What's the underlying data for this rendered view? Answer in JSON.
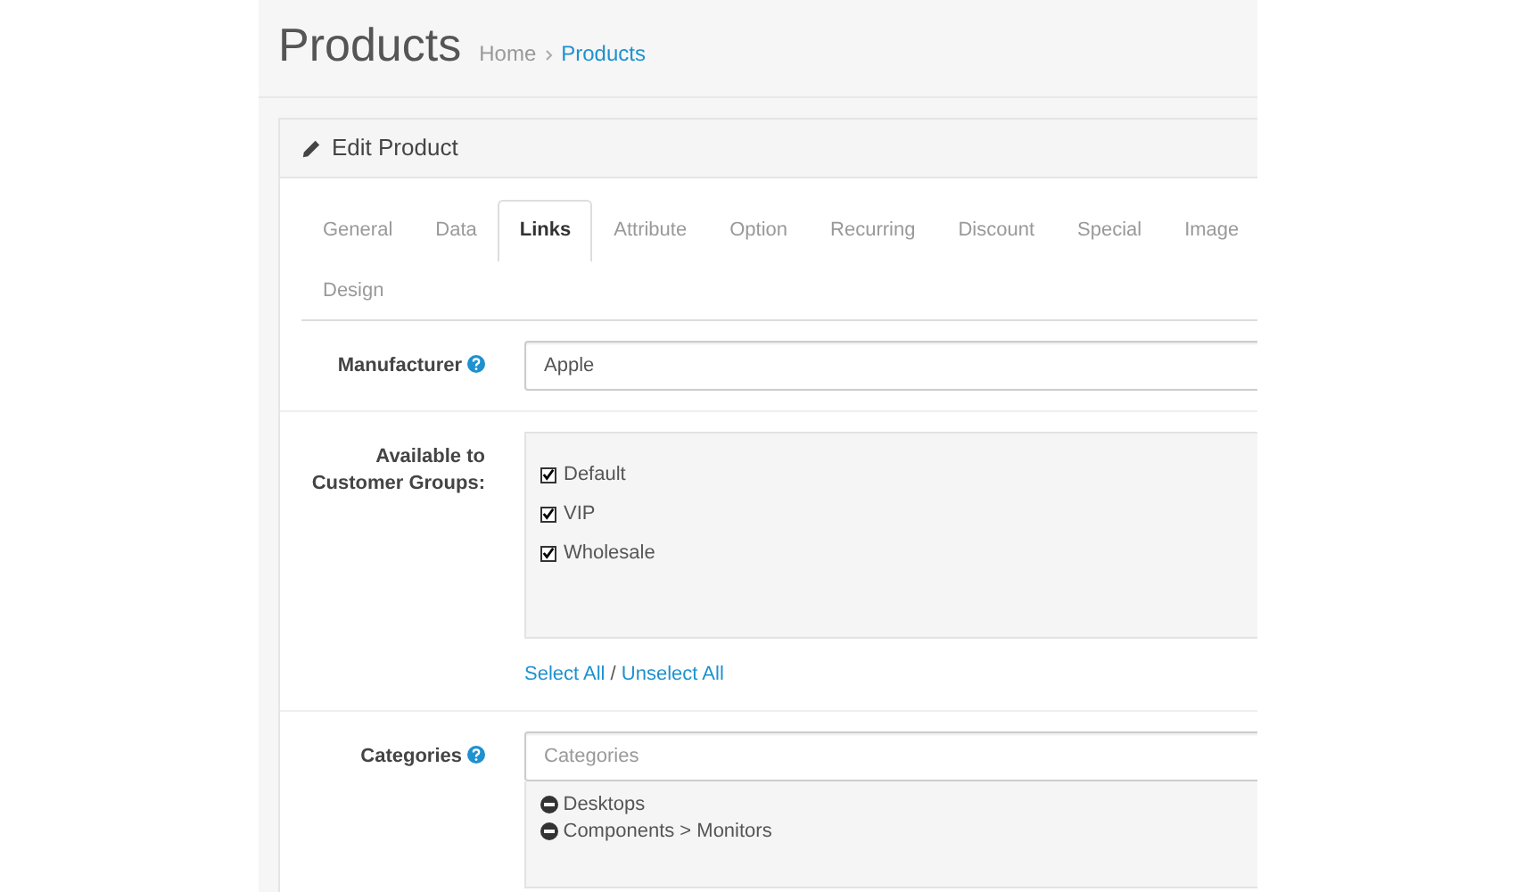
{
  "header": {
    "title": "Products",
    "breadcrumb": [
      {
        "label": "Home",
        "selected": false
      },
      {
        "label": "Products",
        "selected": true
      }
    ]
  },
  "panel": {
    "title": "Edit Product"
  },
  "tabs": [
    {
      "label": "General",
      "selected": false
    },
    {
      "label": "Data",
      "selected": false
    },
    {
      "label": "Links",
      "selected": true
    },
    {
      "label": "Attribute",
      "selected": false
    },
    {
      "label": "Option",
      "selected": false
    },
    {
      "label": "Recurring",
      "selected": false
    },
    {
      "label": "Discount",
      "selected": false
    },
    {
      "label": "Special",
      "selected": false
    },
    {
      "label": "Image",
      "selected": false
    },
    {
      "label": "Design",
      "selected": false
    }
  ],
  "manufacturer": {
    "label": "Manufacturer",
    "value": "Apple"
  },
  "customer_groups": {
    "label": "Available to Customer Groups:",
    "items": [
      {
        "label": "Default",
        "checked": true
      },
      {
        "label": "VIP",
        "checked": true
      },
      {
        "label": "Wholesale",
        "checked": true
      }
    ],
    "select_all": "Select All",
    "separator": "/",
    "unselect_all": "Unselect All"
  },
  "categories": {
    "label": "Categories",
    "placeholder": "Categories",
    "items": [
      "Desktops",
      "Components > Monitors"
    ]
  }
}
